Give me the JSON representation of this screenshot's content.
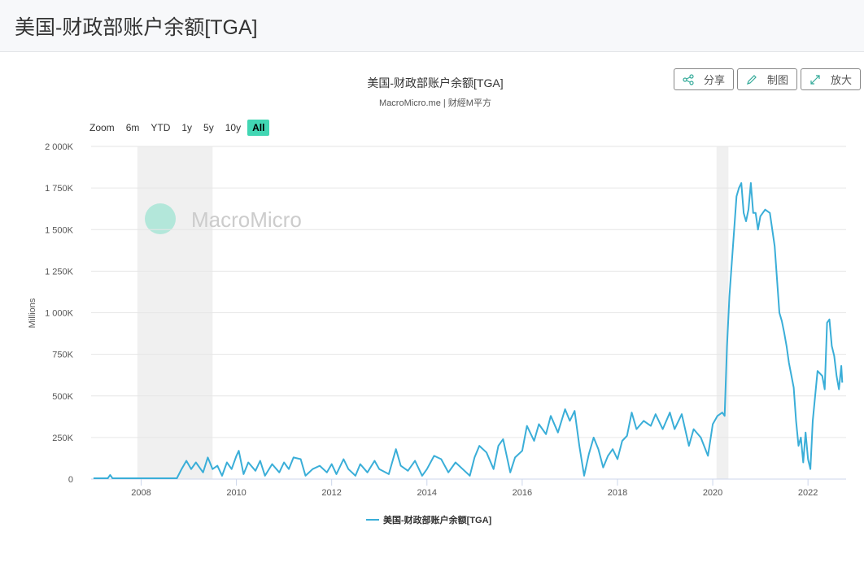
{
  "header": {
    "title": "美国-财政部账户余额[TGA]"
  },
  "toolbar": {
    "share": "分享",
    "draw": "制图",
    "expand": "放大"
  },
  "range_selector": {
    "label": "Zoom",
    "options": [
      "6m",
      "YTD",
      "1y",
      "5y",
      "10y",
      "All"
    ],
    "active": "All"
  },
  "watermark": "MacroMicro",
  "chart_data": {
    "type": "line",
    "title": "美国-财政部账户余额[TGA]",
    "subtitle": "MacroMicro.me | 财經M平方",
    "ylabel": "Millions",
    "xlabel": "",
    "ylim": [
      0,
      2000
    ],
    "xlim": [
      2006.95,
      2022.8
    ],
    "yticks": [
      "0",
      "250K",
      "500K",
      "750K",
      "1 000K",
      "1 250K",
      "1 500K",
      "1 750K",
      "2 000K"
    ],
    "xticks": [
      "2008",
      "2010",
      "2012",
      "2014",
      "2016",
      "2018",
      "2020",
      "2022"
    ],
    "recessions": [
      [
        2007.92,
        2009.5
      ],
      [
        2020.08,
        2020.33
      ]
    ],
    "series": [
      {
        "name": "美国-财政部账户余额[TGA]",
        "color": "#3aaed8",
        "x": [
          2007.0,
          2007.3,
          2007.35,
          2007.4,
          2008.0,
          2008.75,
          2008.85,
          2008.95,
          2009.05,
          2009.15,
          2009.3,
          2009.4,
          2009.5,
          2009.6,
          2009.7,
          2009.8,
          2009.9,
          2010.0,
          2010.05,
          2010.15,
          2010.25,
          2010.4,
          2010.5,
          2010.6,
          2010.75,
          2010.9,
          2011.0,
          2011.1,
          2011.2,
          2011.35,
          2011.45,
          2011.6,
          2011.75,
          2011.9,
          2012.0,
          2012.1,
          2012.25,
          2012.35,
          2012.5,
          2012.6,
          2012.75,
          2012.9,
          2013.0,
          2013.2,
          2013.35,
          2013.45,
          2013.6,
          2013.75,
          2013.9,
          2014.0,
          2014.15,
          2014.3,
          2014.45,
          2014.6,
          2014.75,
          2014.9,
          2015.0,
          2015.1,
          2015.25,
          2015.4,
          2015.5,
          2015.6,
          2015.75,
          2015.85,
          2016.0,
          2016.1,
          2016.25,
          2016.35,
          2016.5,
          2016.6,
          2016.75,
          2016.9,
          2017.0,
          2017.1,
          2017.2,
          2017.3,
          2017.4,
          2017.5,
          2017.6,
          2017.7,
          2017.8,
          2017.9,
          2018.0,
          2018.1,
          2018.2,
          2018.3,
          2018.4,
          2018.55,
          2018.7,
          2018.8,
          2018.95,
          2019.1,
          2019.2,
          2019.35,
          2019.5,
          2019.6,
          2019.75,
          2019.9,
          2020.0,
          2020.1,
          2020.2,
          2020.25,
          2020.3,
          2020.35,
          2020.4,
          2020.45,
          2020.5,
          2020.55,
          2020.6,
          2020.65,
          2020.7,
          2020.75,
          2020.8,
          2020.85,
          2020.9,
          2020.95,
          2021.0,
          2021.1,
          2021.2,
          2021.3,
          2021.4,
          2021.45,
          2021.5,
          2021.55,
          2021.6,
          2021.7,
          2021.75,
          2021.8,
          2021.85,
          2021.9,
          2021.95,
          2022.0,
          2022.05,
          2022.1,
          2022.2,
          2022.3,
          2022.35,
          2022.4,
          2022.45,
          2022.5,
          2022.55,
          2022.6,
          2022.65,
          2022.7,
          2022.72
        ],
        "y": [
          5,
          5,
          25,
          5,
          5,
          5,
          60,
          110,
          60,
          100,
          40,
          130,
          60,
          80,
          20,
          100,
          60,
          140,
          170,
          30,
          100,
          50,
          110,
          20,
          90,
          40,
          100,
          60,
          130,
          120,
          20,
          60,
          80,
          40,
          90,
          30,
          120,
          60,
          20,
          90,
          40,
          110,
          60,
          30,
          180,
          80,
          50,
          110,
          20,
          60,
          140,
          120,
          40,
          100,
          60,
          20,
          130,
          200,
          160,
          60,
          200,
          240,
          40,
          130,
          170,
          320,
          230,
          330,
          270,
          380,
          280,
          420,
          350,
          410,
          200,
          20,
          150,
          250,
          180,
          70,
          140,
          180,
          120,
          230,
          260,
          400,
          300,
          350,
          320,
          390,
          300,
          400,
          300,
          390,
          200,
          300,
          250,
          140,
          330,
          380,
          400,
          380,
          800,
          1100,
          1300,
          1500,
          1700,
          1750,
          1780,
          1600,
          1550,
          1620,
          1780,
          1600,
          1600,
          1500,
          1580,
          1620,
          1600,
          1400,
          1000,
          950,
          880,
          800,
          700,
          550,
          350,
          200,
          250,
          100,
          280,
          120,
          60,
          350,
          650,
          620,
          540,
          940,
          960,
          800,
          740,
          620,
          540,
          680,
          580
        ]
      }
    ]
  }
}
